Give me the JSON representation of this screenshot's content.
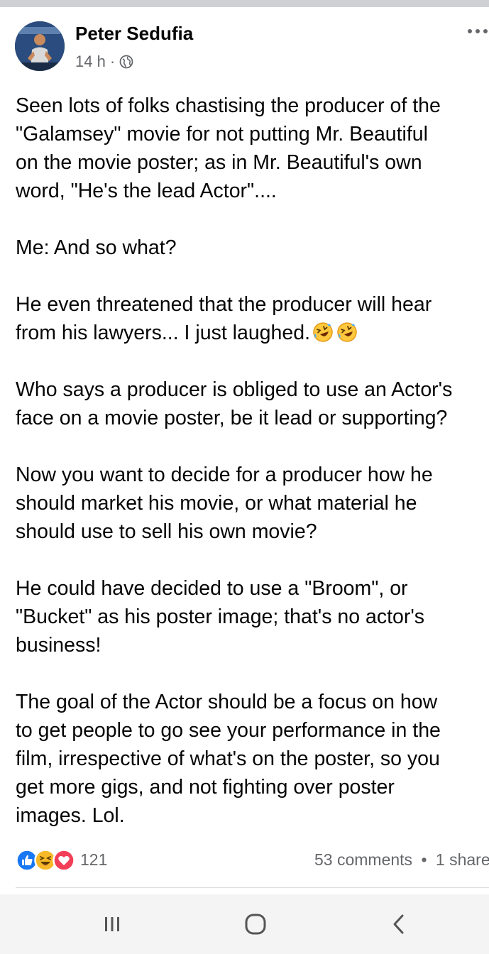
{
  "post": {
    "author": "Peter Sedufia",
    "time": "14 h",
    "visibility_icon": "globe-icon",
    "paragraphs": [
      {
        "lines": [
          "Seen lots of folks chastising the producer of the",
          "\"Galamsey\" movie for not putting Mr. Beautiful",
          "on the movie poster; as in Mr. Beautiful's own",
          "word, \"He's the lead Actor\"...."
        ]
      },
      {
        "lines": [
          "Me: And so what?"
        ]
      },
      {
        "lines": [
          "He even threatened that the producer will hear",
          "from his lawyers... I just laughed."
        ],
        "trailing_emoji": "rolling-on-floor-laughing-emoji"
      },
      {
        "lines": [
          "Who says a producer is obliged to use an Actor's",
          "face on a movie poster, be it lead or supporting?"
        ]
      },
      {
        "lines": [
          "Now you want to decide for a producer how he",
          "should market his movie, or what material he",
          "should use to sell his own movie?"
        ]
      },
      {
        "lines": [
          "He could have decided to use a \"Broom\", or",
          "\"Bucket\" as his poster image; that's no actor's",
          "business!"
        ]
      },
      {
        "lines": [
          "The goal of the Actor should be a focus on how",
          "to get people to go see your performance in the",
          "film, irrespective of what's on the poster, so you",
          "get more gigs, and not fighting over poster",
          "images. Lol."
        ]
      }
    ]
  },
  "reactions": {
    "icons": [
      "like-icon",
      "haha-icon",
      "love-icon"
    ],
    "count": "121",
    "comments": "53 comments",
    "shares": "1 share",
    "colors": {
      "like": "#1877f2",
      "haha": "#f7b928",
      "love": "#f33e58"
    }
  },
  "system_nav": {
    "buttons": [
      "recent-apps-icon",
      "home-icon",
      "back-icon"
    ]
  }
}
